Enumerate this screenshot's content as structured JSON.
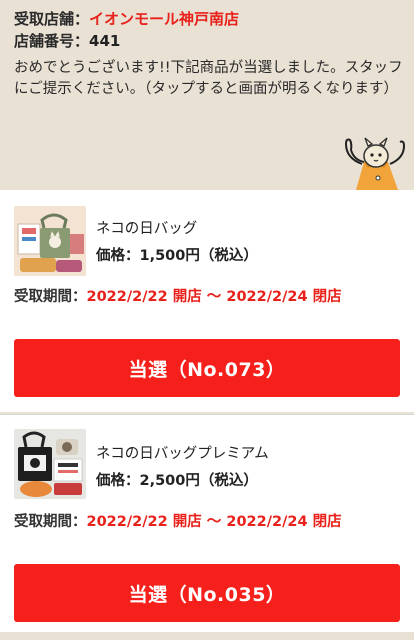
{
  "store": {
    "label": "受取店舗：",
    "name": "イオンモール神戸南店",
    "number_label": "店舗番号：",
    "number": "441"
  },
  "message": "おめでとうございます!!下記商品が当選しました。スタッフにご提示ください。（タップすると画面が明るくなります）",
  "items": [
    {
      "name": "ネコの日バッグ",
      "price_label": "価格：",
      "price": "1,500円（税込）",
      "period_label": "受取期間：",
      "period": "2022/2/22 開店 〜 2022/2/24 閉店",
      "button": "当選（No.073）"
    },
    {
      "name": "ネコの日バッグプレミアム",
      "price_label": "価格：",
      "price": "2,500円（税込）",
      "period_label": "受取期間：",
      "period": "2022/2/22 開店 〜 2022/2/24 閉店",
      "button": "当選（No.035）"
    }
  ],
  "colors": {
    "accent_red": "#f5201b",
    "text_red": "#e8211a",
    "header_bg": "#e9e1d4"
  }
}
